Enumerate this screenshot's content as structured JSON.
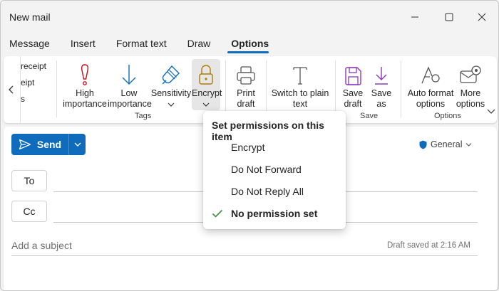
{
  "window": {
    "title": "New mail"
  },
  "tabs": [
    {
      "label": "Message"
    },
    {
      "label": "Insert"
    },
    {
      "label": "Format text"
    },
    {
      "label": "Draw"
    },
    {
      "label": "Options",
      "active": true
    }
  ],
  "ribbon": {
    "partial_items": [
      "receipt",
      "eipt",
      "s"
    ],
    "tags": {
      "group_label": "Tags",
      "high_importance": {
        "line1": "High",
        "line2": "importance"
      },
      "low_importance": {
        "line1": "Low",
        "line2": "importance"
      },
      "sensitivity": {
        "label": "Sensitivity"
      },
      "encrypt": {
        "label": "Encrypt"
      }
    },
    "print_draft": {
      "line1": "Print",
      "line2": "draft"
    },
    "switch_plain": {
      "line1": "Switch to plain",
      "line2": "text"
    },
    "save": {
      "group_label": "Save",
      "save_draft": {
        "line1": "Save",
        "line2": "draft"
      },
      "save_as": {
        "line1": "Save",
        "line2": "as"
      }
    },
    "options": {
      "group_label": "Options",
      "auto_format": {
        "line1": "Auto format",
        "line2": "options"
      },
      "more_options": {
        "line1": "More",
        "line2": "options"
      }
    }
  },
  "compose": {
    "send_label": "Send",
    "sensitivity_label": "General",
    "to_label": "To",
    "cc_label": "Cc",
    "subject_placeholder": "Add a subject",
    "draft_status": "Draft saved at 2:16 AM"
  },
  "permissions_menu": {
    "title": "Set permissions on this item",
    "items": [
      {
        "label": "Encrypt",
        "checked": false
      },
      {
        "label": "Do Not Forward",
        "checked": false
      },
      {
        "label": "Do Not Reply All",
        "checked": false
      },
      {
        "label": "No permission set",
        "checked": true
      }
    ]
  },
  "colors": {
    "accent": "#0f6cbd",
    "important": "#c50f1f",
    "save_purple": "#8a3ab9",
    "check_green": "#3e8e41"
  }
}
